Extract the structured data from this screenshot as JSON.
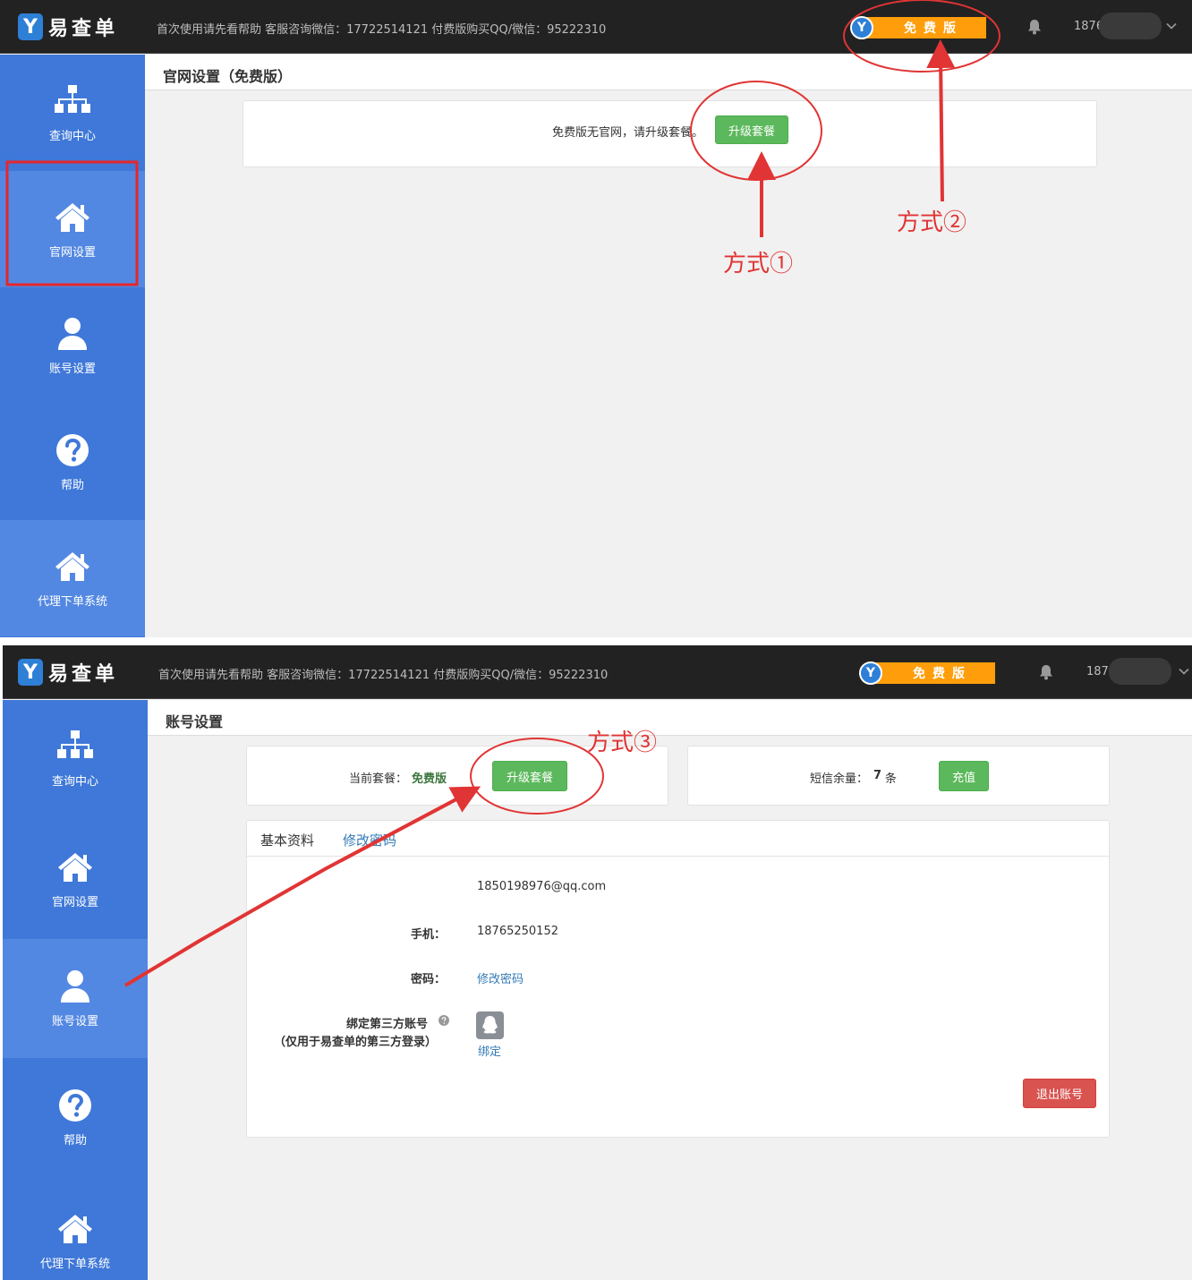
{
  "brand": {
    "logo_letter": "Y",
    "name": "易查单"
  },
  "header": {
    "notice": "首次使用请先看帮助 客服咨询微信：17722514121 付费版购买QQ/微信：95222310",
    "plan_badge": "免费版",
    "plan_letter": "Y",
    "user_phone_partial_1": "1876",
    "user_phone_partial_2": "187"
  },
  "sidebar": {
    "items": [
      {
        "label": "查询中心",
        "icon": "sitemap-icon"
      },
      {
        "label": "官网设置",
        "icon": "home-icon"
      },
      {
        "label": "账号设置",
        "icon": "user-icon"
      },
      {
        "label": "帮助",
        "icon": "question-circle-icon"
      },
      {
        "label": "代理下单系统",
        "icon": "home-icon"
      }
    ]
  },
  "site_settings": {
    "title": "官网设置（免费版）",
    "message": "免费版无官网，请升级套餐。",
    "upgrade_label": "升级套餐"
  },
  "account_settings": {
    "title": "账号设置",
    "current_plan_label": "当前套餐：",
    "current_plan_value": "免费版",
    "upgrade_label": "升级套餐",
    "sms_label": "短信余量：",
    "sms_count": "7",
    "sms_unit": "条",
    "recharge_label": "充值",
    "tabs": [
      {
        "label": "基本资料"
      },
      {
        "label": "修改密码"
      }
    ],
    "email": "1850198976@qq.com",
    "phone_label": "手机：",
    "phone_value": "18765250152",
    "password_label": "密码：",
    "password_link": "修改密码",
    "bind_label": "绑定第三方账号",
    "bind_note": "（仅用于易查单的第三方登录）",
    "bind_link": "绑定",
    "logout_label": "退出账号"
  },
  "annotations": {
    "method_1": "方式①",
    "method_2": "方式②",
    "method_3": "方式③",
    "color": "#e13434"
  },
  "colors": {
    "topbar": "#222222",
    "sidebar": "#3f78d8",
    "sidebar_active": "#5388e2",
    "badge": "#ff9d0a",
    "green_button": "#5cb85c",
    "red_button": "#d9534f",
    "link": "#337ab7"
  }
}
